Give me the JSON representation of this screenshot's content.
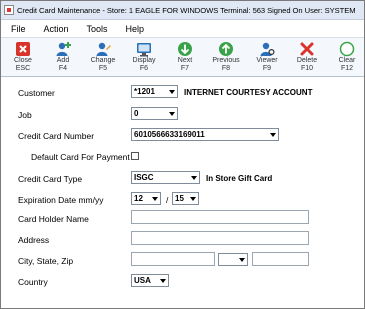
{
  "titlebar": {
    "title": "Credit Card Maintenance - Store: 1   EAGLE FOR WINDOWS   Terminal: 563   Signed On User: SYSTEM"
  },
  "menu": [
    "File",
    "Action",
    "Tools",
    "Help"
  ],
  "toolbar": [
    {
      "label": "Close",
      "key": "ESC",
      "icon": "close-icon",
      "color": "#d9342b"
    },
    {
      "label": "Add",
      "key": "F4",
      "icon": "add-user-icon",
      "color": "#2a6fb8"
    },
    {
      "label": "Change",
      "key": "F5",
      "icon": "change-user-icon",
      "color": "#2a6fb8"
    },
    {
      "label": "Display",
      "key": "F6",
      "icon": "display-icon",
      "color": "#2a6fb8"
    },
    {
      "label": "Next",
      "key": "F7",
      "icon": "next-icon",
      "color": "#3aa34a"
    },
    {
      "label": "Previous",
      "key": "F8",
      "icon": "previous-icon",
      "color": "#3aa34a"
    },
    {
      "label": "Viewer",
      "key": "F9",
      "icon": "viewer-icon",
      "color": "#2a6fb8"
    },
    {
      "label": "Delete",
      "key": "F10",
      "icon": "delete-icon",
      "color": "#d9342b"
    },
    {
      "label": "Clear",
      "key": "F12",
      "icon": "clear-icon",
      "color": "#3aa34a"
    }
  ],
  "form": {
    "customer": {
      "label": "Customer",
      "value": "*1201",
      "description": "INTERNET COURTESY ACCOUNT"
    },
    "job": {
      "label": "Job",
      "value": "0"
    },
    "card_number": {
      "label": "Credit Card Number",
      "value": "6010566633169011"
    },
    "default_card": {
      "label": "Default Card For Payment",
      "checked": false
    },
    "card_type": {
      "label": "Credit Card Type",
      "value": "ISGC",
      "description": "In Store Gift Card"
    },
    "expiration": {
      "label": "Expiration Date mm/yy",
      "month": "12",
      "separator": "/",
      "year": "15"
    },
    "holder_name": {
      "label": "Card Holder Name",
      "value": ""
    },
    "address": {
      "label": "Address",
      "value": ""
    },
    "city_state_zip": {
      "label": "City, State, Zip",
      "city": "",
      "state": "",
      "zip": ""
    },
    "country": {
      "label": "Country",
      "value": "USA"
    }
  }
}
